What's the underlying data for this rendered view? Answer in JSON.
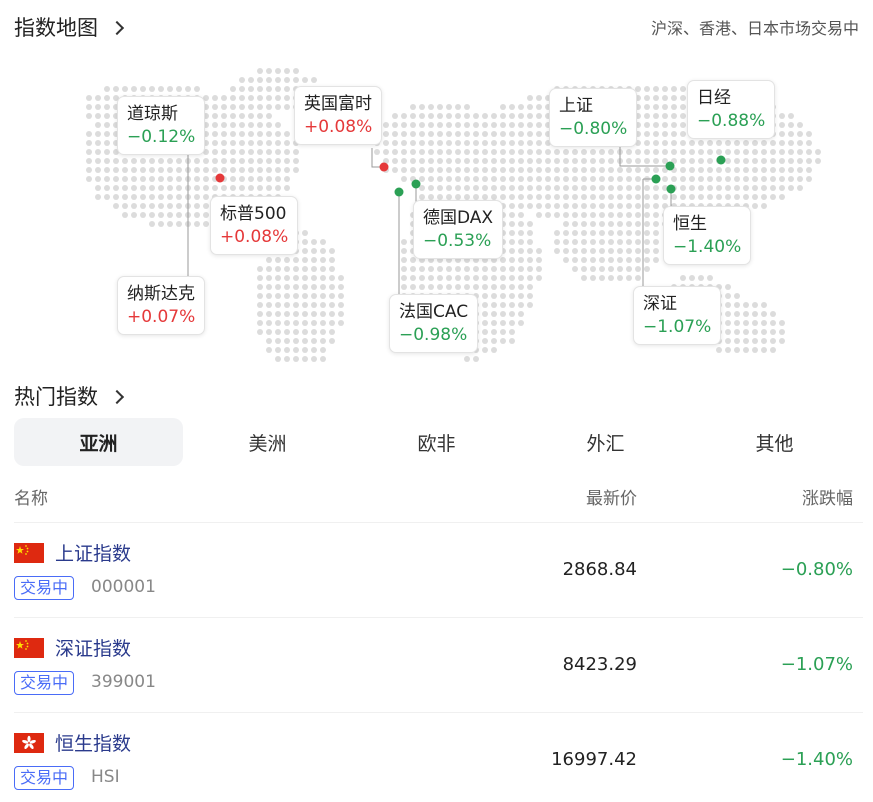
{
  "map_section": {
    "title": "指数地图",
    "subtitle": "沪深、香港、日本市场交易中",
    "markers": [
      {
        "name": "道琼斯",
        "change": "−0.12%",
        "trend": "down"
      },
      {
        "name": "标普500",
        "change": "+0.08%",
        "trend": "up"
      },
      {
        "name": "纳斯达克",
        "change": "+0.07%",
        "trend": "up"
      },
      {
        "name": "英国富时",
        "change": "+0.08%",
        "trend": "up"
      },
      {
        "name": "德国DAX",
        "change": "−0.53%",
        "trend": "down"
      },
      {
        "name": "法国CAC",
        "change": "−0.98%",
        "trend": "down"
      },
      {
        "name": "上证",
        "change": "−0.80%",
        "trend": "down"
      },
      {
        "name": "日经",
        "change": "−0.88%",
        "trend": "down"
      },
      {
        "name": "恒生",
        "change": "−1.40%",
        "trend": "down"
      },
      {
        "name": "深证",
        "change": "−1.07%",
        "trend": "down"
      }
    ]
  },
  "hot_section": {
    "title": "热门指数",
    "tabs": [
      "亚洲",
      "美洲",
      "欧非",
      "外汇",
      "其他"
    ],
    "active_tab": "亚洲",
    "columns": {
      "name": "名称",
      "price": "最新价",
      "change": "涨跌幅"
    },
    "rows": [
      {
        "flag": "china-flag-icon",
        "name": "上证指数",
        "status": "交易中",
        "code": "000001",
        "price": "2868.84",
        "change": "−0.80%",
        "trend": "down"
      },
      {
        "flag": "china-flag-icon",
        "name": "深证指数",
        "status": "交易中",
        "code": "399001",
        "price": "8423.29",
        "change": "−1.07%",
        "trend": "down"
      },
      {
        "flag": "hongkong-flag-icon",
        "name": "恒生指数",
        "status": "交易中",
        "code": "HSI",
        "price": "16997.42",
        "change": "−1.40%",
        "trend": "down"
      }
    ]
  },
  "colors": {
    "up": "#e5393a",
    "down": "#2ba055",
    "link": "#2a3a8c",
    "badge": "#4a6cf7",
    "map_dot": "#dcdcdc"
  }
}
